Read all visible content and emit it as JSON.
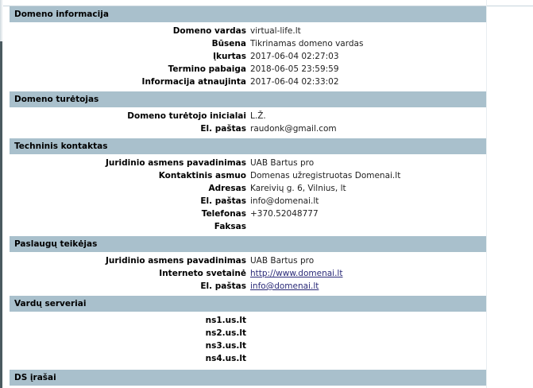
{
  "sections": {
    "domain_info": {
      "title": "Domeno informacija",
      "rows": [
        {
          "label": "Domeno vardas",
          "value": "virtual-life.lt"
        },
        {
          "label": "Būsena",
          "value": "Tikrinamas domeno vardas"
        },
        {
          "label": "Įkurtas",
          "value": "2017-06-04 02:27:03"
        },
        {
          "label": "Termino pabaiga",
          "value": "2018-06-05 23:59:59"
        },
        {
          "label": "Informacija atnaujinta",
          "value": "2017-06-04 02:33:02"
        }
      ]
    },
    "holder": {
      "title": "Domeno turėtojas",
      "rows": [
        {
          "label": "Domeno turėtojo inicialai",
          "value": "L.Ž."
        },
        {
          "label": "El. paštas",
          "value": "raudonk@gmail.com"
        }
      ]
    },
    "tech": {
      "title": "Techninis kontaktas",
      "rows": [
        {
          "label": "Juridinio asmens pavadinimas",
          "value": "UAB Bartus pro"
        },
        {
          "label": "Kontaktinis asmuo",
          "value": "Domenas užregistruotas Domenai.lt"
        },
        {
          "label": "Adresas",
          "value": "Kareivių g. 6, Vilnius, lt"
        },
        {
          "label": "El. paštas",
          "value": "info@domenai.lt"
        },
        {
          "label": "Telefonas",
          "value": "+370.52048777"
        },
        {
          "label": "Faksas",
          "value": ""
        }
      ]
    },
    "provider": {
      "title": "Paslaugų teikėjas",
      "rows": [
        {
          "label": "Juridinio asmens pavadinimas",
          "value": "UAB Bartus pro"
        },
        {
          "label": "Interneto svetainė",
          "value": "http://www.domenai.lt"
        },
        {
          "label": "El. paštas",
          "value": "info@domenai.lt"
        }
      ]
    },
    "ns": {
      "title": "Vardų serveriai",
      "items": [
        "ns1.us.lt",
        "ns2.us.lt",
        "ns3.us.lt",
        "ns4.us.lt"
      ]
    },
    "ds": {
      "title": "DS įrašai"
    }
  },
  "colors": {
    "section_header_bg": "#a9c0cc",
    "link": "#2a2a78"
  }
}
